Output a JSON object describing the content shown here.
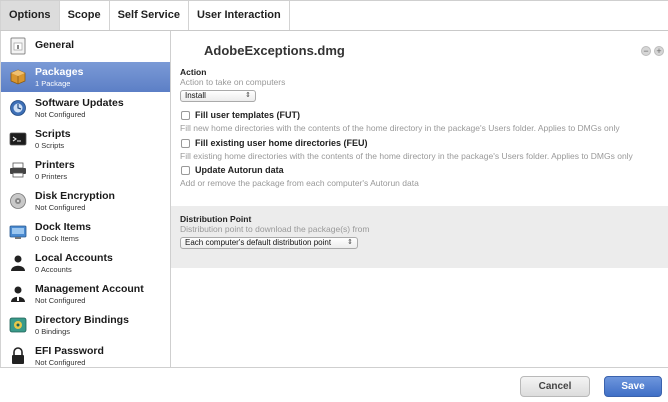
{
  "tabs": [
    "Options",
    "Scope",
    "Self Service",
    "User Interaction"
  ],
  "sidebar": {
    "items": [
      {
        "name": "General",
        "sub": ""
      },
      {
        "name": "Packages",
        "sub": "1 Package"
      },
      {
        "name": "Software Updates",
        "sub": "Not Configured"
      },
      {
        "name": "Scripts",
        "sub": "0 Scripts"
      },
      {
        "name": "Printers",
        "sub": "0 Printers"
      },
      {
        "name": "Disk Encryption",
        "sub": "Not Configured"
      },
      {
        "name": "Dock Items",
        "sub": "0 Dock Items"
      },
      {
        "name": "Local Accounts",
        "sub": "0 Accounts"
      },
      {
        "name": "Management Account",
        "sub": "Not Configured"
      },
      {
        "name": "Directory Bindings",
        "sub": "0 Bindings"
      },
      {
        "name": "EFI Password",
        "sub": "Not Configured"
      }
    ]
  },
  "main": {
    "title": "AdobeExceptions.dmg",
    "remove_symbol": "−",
    "add_symbol": "+",
    "action": {
      "label": "Action",
      "hint": "Action to take on computers",
      "selected": "Install",
      "arrow": "⇕"
    },
    "options": [
      {
        "label": "Fill user templates (FUT)",
        "hint": "Fill new home directories with the contents of the home directory in the package's Users folder. Applies to DMGs only"
      },
      {
        "label": "Fill existing user home directories (FEU)",
        "hint": "Fill existing home directories with the contents of the home directory in the package's Users folder. Applies to DMGs only"
      },
      {
        "label": "Update Autorun data",
        "hint": "Add or remove the package from each computer's Autorun data"
      }
    ],
    "distribution": {
      "label": "Distribution Point",
      "hint": "Distribution point to download the package(s) from",
      "selected": "Each computer's default distribution point",
      "arrow": "⇕"
    }
  },
  "footer": {
    "cancel_label": "Cancel",
    "save_label": "Save"
  },
  "colors": {
    "active_sidebar": "#6d8fd1",
    "save_button": "#4a78cc",
    "active_tab": "#dcdcdc",
    "distribution_panel": "#ececec"
  }
}
